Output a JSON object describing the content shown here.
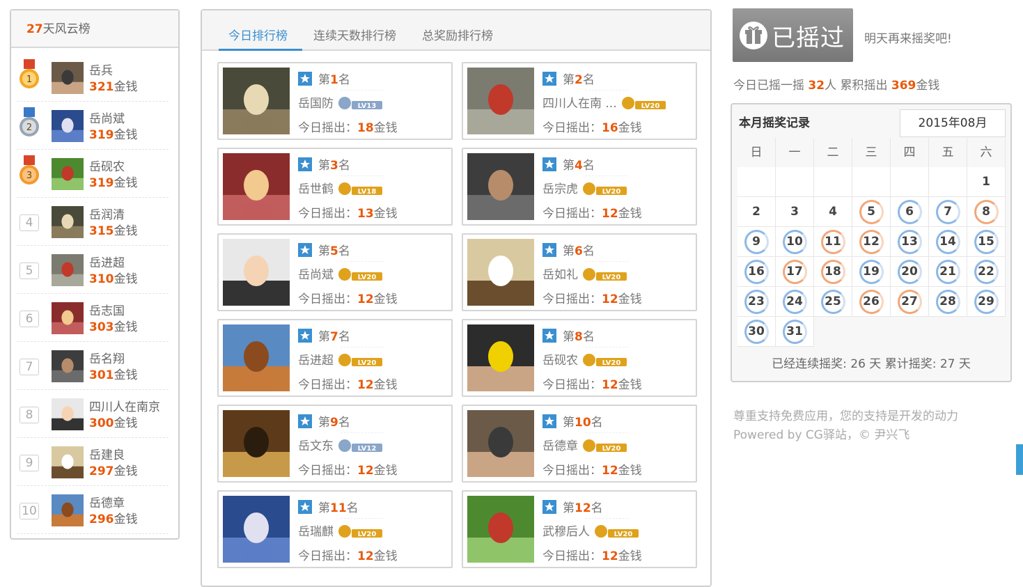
{
  "left": {
    "days": "27",
    "title": "天风云榜",
    "items": [
      {
        "rank": "1",
        "name": "岳兵",
        "coins": "321",
        "unit": "金钱",
        "medal": "gold"
      },
      {
        "rank": "2",
        "name": "岳尚斌",
        "coins": "319",
        "unit": "金钱",
        "medal": "silver"
      },
      {
        "rank": "3",
        "name": "岳砚农",
        "coins": "319",
        "unit": "金钱",
        "medal": "bronze"
      },
      {
        "rank": "4",
        "name": "岳润清",
        "coins": "315",
        "unit": "金钱"
      },
      {
        "rank": "5",
        "name": "岳进超",
        "coins": "310",
        "unit": "金钱"
      },
      {
        "rank": "6",
        "name": "岳志国",
        "coins": "303",
        "unit": "金钱"
      },
      {
        "rank": "7",
        "name": "岳名翔",
        "coins": "301",
        "unit": "金钱"
      },
      {
        "rank": "8",
        "name": "四川人在南京",
        "coins": "300",
        "unit": "金钱"
      },
      {
        "rank": "9",
        "name": "岳建良",
        "coins": "297",
        "unit": "金钱"
      },
      {
        "rank": "10",
        "name": "岳德章",
        "coins": "296",
        "unit": "金钱"
      }
    ]
  },
  "tabs": [
    "今日排行榜",
    "连续天数排行榜",
    "总奖励排行榜"
  ],
  "cards": [
    {
      "place_pre": "第",
      "place": "1",
      "place_post": "名",
      "name": "岳国防",
      "level": "LV13",
      "today_label": "今日摇出：",
      "amount": "18",
      "unit": "金钱"
    },
    {
      "place_pre": "第",
      "place": "2",
      "place_post": "名",
      "name": "四川人在南 ...",
      "level": "LV20",
      "today_label": "今日摇出：",
      "amount": "16",
      "unit": "金钱"
    },
    {
      "place_pre": "第",
      "place": "3",
      "place_post": "名",
      "name": "岳世鹤",
      "level": "LV18",
      "today_label": "今日摇出：",
      "amount": "13",
      "unit": "金钱"
    },
    {
      "place_pre": "第",
      "place": "4",
      "place_post": "名",
      "name": "岳宗虎",
      "level": "LV20",
      "today_label": "今日摇出：",
      "amount": "12",
      "unit": "金钱"
    },
    {
      "place_pre": "第",
      "place": "5",
      "place_post": "名",
      "name": "岳尚斌",
      "level": "LV20",
      "today_label": "今日摇出：",
      "amount": "12",
      "unit": "金钱"
    },
    {
      "place_pre": "第",
      "place": "6",
      "place_post": "名",
      "name": "岳如礼",
      "level": "LV20",
      "today_label": "今日摇出：",
      "amount": "12",
      "unit": "金钱"
    },
    {
      "place_pre": "第",
      "place": "7",
      "place_post": "名",
      "name": "岳进超",
      "level": "LV20",
      "today_label": "今日摇出：",
      "amount": "12",
      "unit": "金钱"
    },
    {
      "place_pre": "第",
      "place": "8",
      "place_post": "名",
      "name": "岳砚农",
      "level": "LV20",
      "today_label": "今日摇出：",
      "amount": "12",
      "unit": "金钱"
    },
    {
      "place_pre": "第",
      "place": "9",
      "place_post": "名",
      "name": "岳文东",
      "level": "LV12",
      "today_label": "今日摇出：",
      "amount": "12",
      "unit": "金钱"
    },
    {
      "place_pre": "第",
      "place": "10",
      "place_post": "名",
      "name": "岳德章",
      "level": "LV20",
      "today_label": "今日摇出：",
      "amount": "12",
      "unit": "金钱"
    },
    {
      "place_pre": "第",
      "place": "11",
      "place_post": "名",
      "name": "岳瑞麒",
      "level": "LV20",
      "today_label": "今日摇出：",
      "amount": "12",
      "unit": "金钱"
    },
    {
      "place_pre": "第",
      "place": "12",
      "place_post": "名",
      "name": "武穆后人",
      "level": "LV20",
      "today_label": "今日摇出：",
      "amount": "12",
      "unit": "金钱"
    }
  ],
  "shake": {
    "button": "已摇过",
    "tomorrow": "明天再来摇奖吧!"
  },
  "stats": {
    "pre": "今日已摇一摇 ",
    "people": "32",
    "mid": "人 累积摇出 ",
    "coins": "369",
    "post": "金钱"
  },
  "calendar": {
    "title": "本月摇奖记录",
    "month": "2015年08月",
    "weekdays": [
      "日",
      "一",
      "二",
      "三",
      "四",
      "五",
      "六"
    ],
    "orange_days": [
      5,
      8,
      11,
      12,
      17,
      18,
      26,
      27
    ],
    "footer": "已经连续摇奖: 26 天  累计摇奖: 27 天"
  },
  "support": "尊重支持免费应用，您的支持是开发的动力",
  "powered": "Powered by CG驿站，© 尹兴飞",
  "colors": {
    "accent": "#3a8fd0",
    "highlight": "#e8590c"
  }
}
